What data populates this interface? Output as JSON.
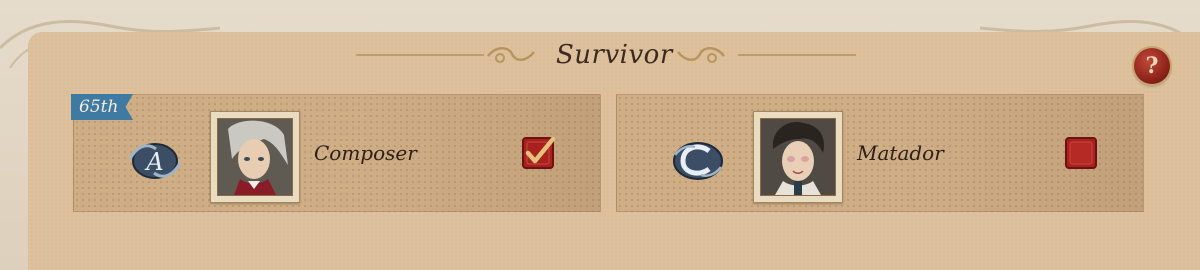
{
  "header": {
    "title": "Survivor",
    "help_label": "?"
  },
  "characters": [
    {
      "rank": "65th",
      "name": "Composer",
      "emblem_letter": "A",
      "selected": true
    },
    {
      "rank": "",
      "name": "Matador",
      "emblem_letter": "C",
      "selected": false
    }
  ],
  "colors": {
    "panel": "#dcbf9a",
    "card": "#cfae86",
    "rank_badge": "#3f7aa3",
    "checkbox_red": "#a8211e",
    "check_gold": "#e2c27a",
    "title_text": "#3a2a1f"
  },
  "icons": {
    "help": "question-mark-icon",
    "emblem1": "letter-a-emblem-icon",
    "emblem2": "letter-c-emblem-icon",
    "checkbox": "checkmark-icon"
  }
}
